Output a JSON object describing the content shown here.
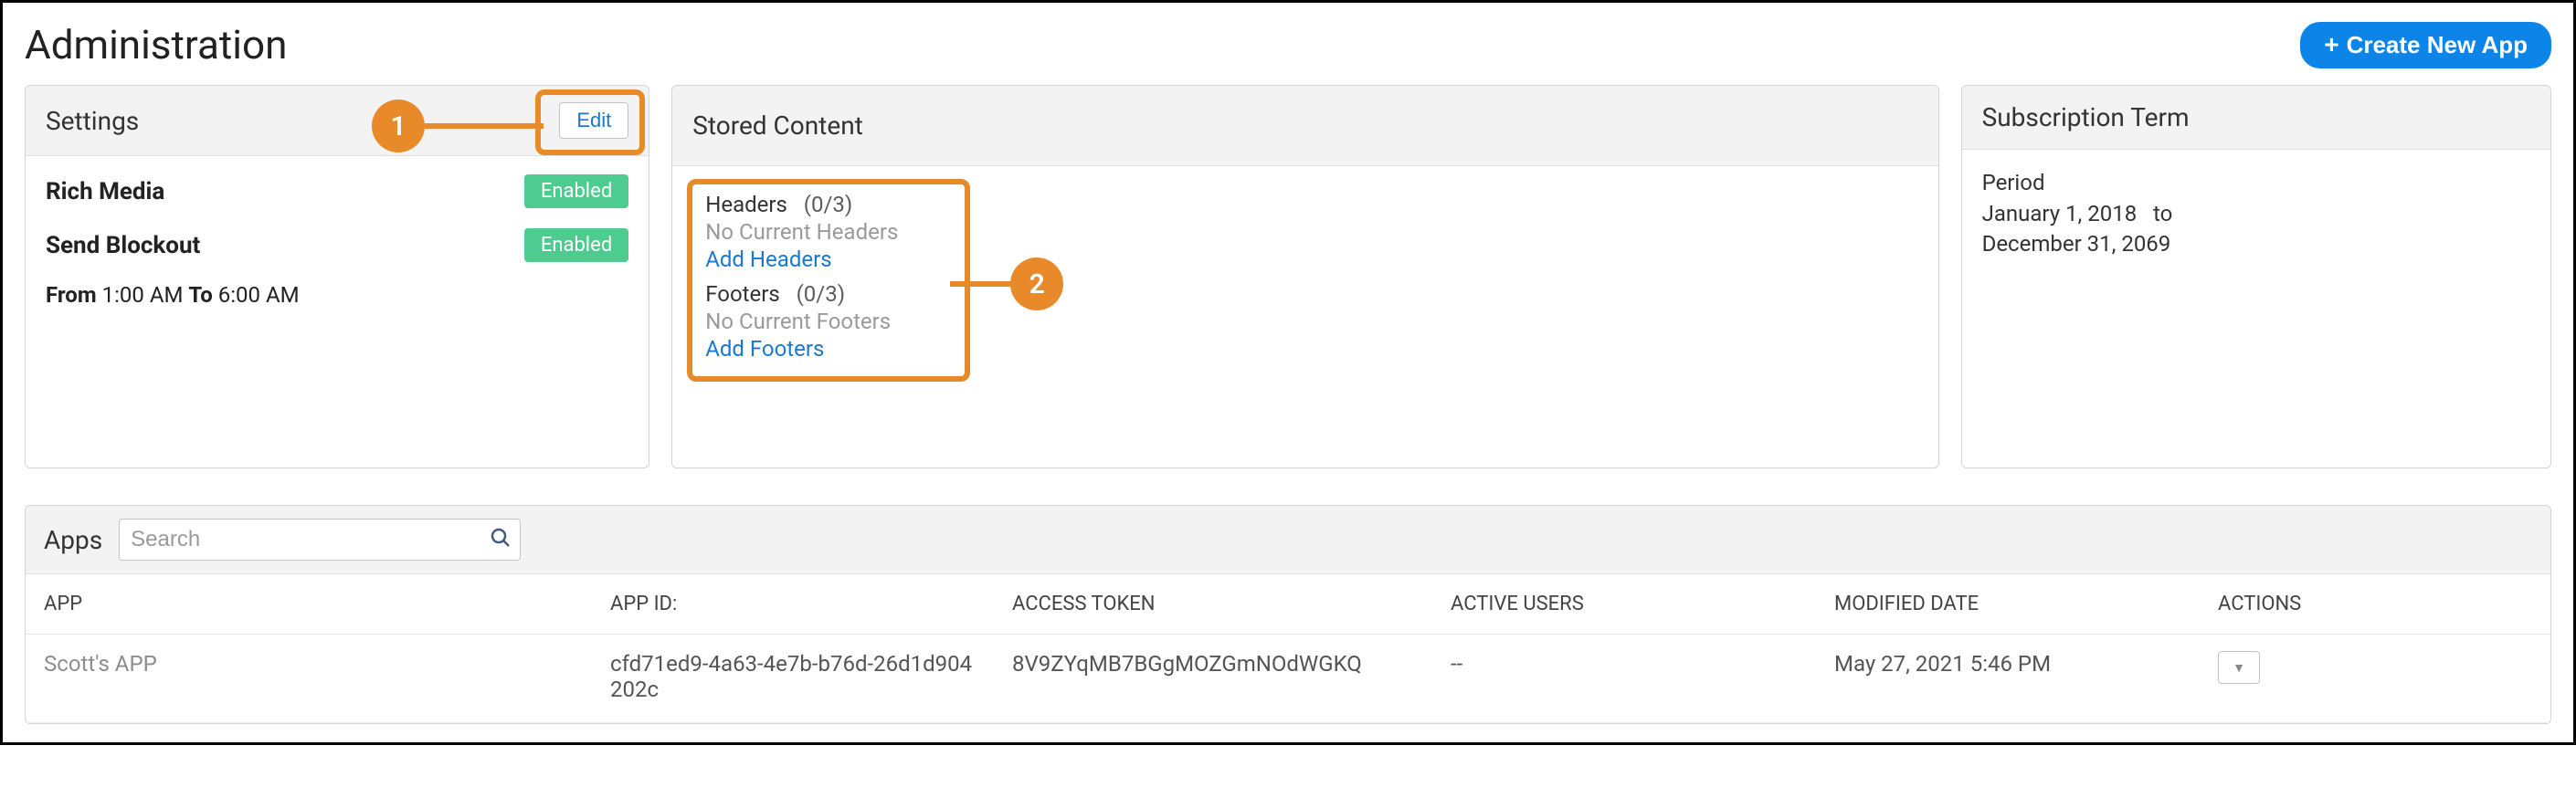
{
  "page": {
    "title": "Administration",
    "create_button": "Create New App"
  },
  "settings": {
    "title": "Settings",
    "edit_label": "Edit",
    "rich_media": {
      "label": "Rich Media",
      "status": "Enabled"
    },
    "send_blockout": {
      "label": "Send Blockout",
      "status": "Enabled"
    },
    "from_label": "From",
    "from_time": "1:00 AM",
    "to_label": "To",
    "to_time": "6:00 AM"
  },
  "stored": {
    "title": "Stored Content",
    "headers_label": "Headers",
    "headers_count": "(0/3)",
    "headers_empty": "No Current Headers",
    "add_headers": "Add Headers",
    "footers_label": "Footers",
    "footers_count": "(0/3)",
    "footers_empty": "No Current Footers",
    "add_footers": "Add Footers"
  },
  "subscription": {
    "title": "Subscription Term",
    "period_label": "Period",
    "start": "January 1, 2018",
    "to": "to",
    "end": "December 31, 2069"
  },
  "callouts": {
    "one": "1",
    "two": "2"
  },
  "apps": {
    "title": "Apps",
    "search_placeholder": "Search",
    "columns": {
      "app": "APP",
      "app_id": "APP ID:",
      "access_token": "ACCESS TOKEN",
      "active_users": "ACTIVE USERS",
      "modified": "MODIFIED DATE",
      "actions": "ACTIONS"
    },
    "rows": [
      {
        "name": "Scott's APP",
        "app_id": "cfd71ed9-4a63-4e7b-b76d-26d1d904202c",
        "access_token": "8V9ZYqMB7BGgMOZGmNOdWGKQ",
        "active_users": "--",
        "modified": "May 27, 2021 5:46 PM"
      }
    ]
  }
}
